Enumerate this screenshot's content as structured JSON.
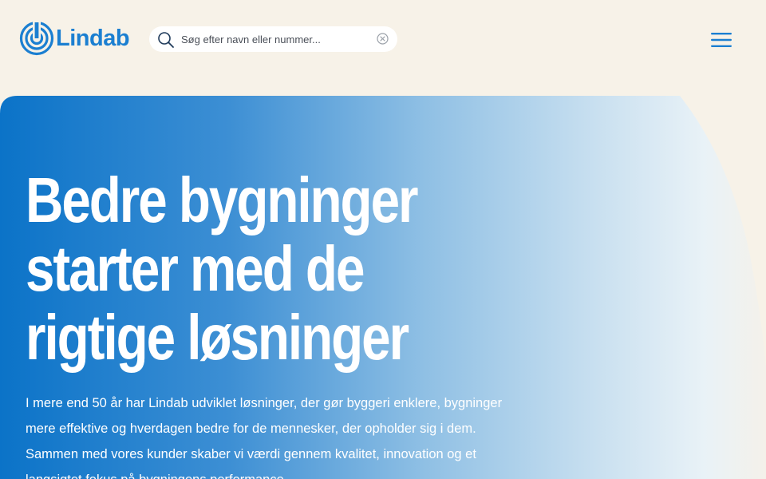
{
  "header": {
    "logo_text": "Lindab",
    "search": {
      "placeholder": "Søg efter navn eller nummer...",
      "value": ""
    },
    "menu_icon": "hamburger-menu-icon"
  },
  "hero": {
    "title": "Bedre bygninger\nstarter med de\nrigtige løsninger",
    "text": "I mere end 50 år har Lindab udviklet løsninger, der gør byggeri enklere, bygninger mere effektive og hverdagen bedre for de mennesker, der opholder sig i dem. Sammen med vores kunder skaber vi værdi gennem kvalitet, innovation og et langsigtet fokus på bygningens performance."
  },
  "colors": {
    "background": "#f7f2e8",
    "brand_blue": "#1b7fd1",
    "hero_gradient_start": "#0b73c8",
    "hero_gradient_end": "#eaf3f8",
    "text_on_hero": "#ffffff"
  }
}
